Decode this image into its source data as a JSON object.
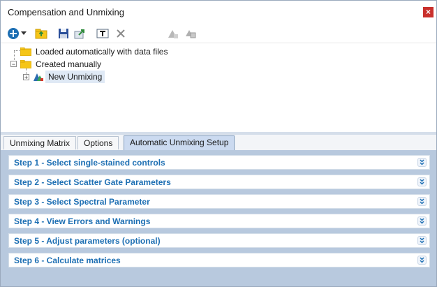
{
  "window": {
    "title": "Compensation and Unmixing",
    "close_label": "×"
  },
  "toolbar": {
    "buttons": [
      {
        "icon": "add-icon"
      },
      {
        "icon": "dropdown-arrow-icon"
      },
      {
        "icon": "open-folder-icon"
      },
      {
        "icon": "save-icon"
      },
      {
        "icon": "export-icon"
      },
      {
        "icon": "rename-icon"
      },
      {
        "icon": "delete-icon"
      },
      {
        "icon": "apply-icon"
      },
      {
        "icon": "copy-icon"
      }
    ]
  },
  "tree": {
    "items": [
      {
        "label": "Loaded automatically with data files"
      },
      {
        "label": "Created manually"
      },
      {
        "label": "New Unmixing"
      }
    ]
  },
  "tabs": [
    {
      "label": "Unmixing Matrix"
    },
    {
      "label": "Options"
    },
    {
      "label": "Automatic Unmixing Setup"
    }
  ],
  "steps": [
    {
      "label": "Step 1 - Select single-stained controls"
    },
    {
      "label": "Step 2 - Select Scatter Gate Parameters"
    },
    {
      "label": "Step 3 - Select Spectral Parameter"
    },
    {
      "label": "Step 4 - View Errors and Warnings"
    },
    {
      "label": "Step 5 - Adjust parameters (optional)"
    },
    {
      "label": "Step 6 - Calculate matrices"
    }
  ],
  "colors": {
    "accent": "#1d6fb3",
    "panel": "#b8c9de",
    "active_tab": "#cbdaf0",
    "folder": "#f5c518"
  }
}
